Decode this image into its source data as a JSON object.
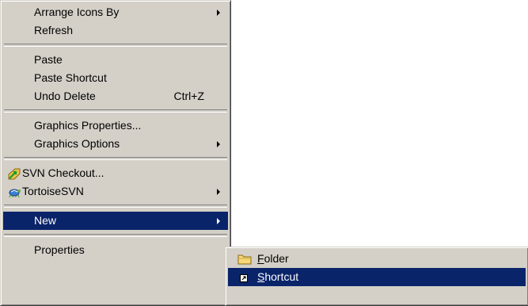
{
  "context_menu": {
    "items": [
      {
        "label": "Arrange Icons By"
      },
      {
        "label": "Refresh"
      },
      {
        "label": "Paste"
      },
      {
        "label": "Paste Shortcut"
      },
      {
        "label": "Undo Delete",
        "accel": "Ctrl+Z"
      },
      {
        "label": "Graphics Properties..."
      },
      {
        "label": "Graphics Options"
      },
      {
        "label": "SVN Checkout...",
        "icon": "svn-checkout-icon"
      },
      {
        "label": "TortoiseSVN",
        "icon": "tortoisesvn-icon"
      },
      {
        "label": "New",
        "state": "highlighted"
      },
      {
        "label": "Properties"
      }
    ]
  },
  "new_submenu": {
    "items": [
      {
        "mnemonic": "F",
        "rest": "older",
        "icon": "folder-icon"
      },
      {
        "mnemonic": "S",
        "rest": "hortcut",
        "icon": "shortcut-icon",
        "state": "highlighted"
      }
    ]
  },
  "colors": {
    "menu_face": "#d4d0c8",
    "highlight": "#0a246a",
    "highlight_text": "#ffffff",
    "desktop": "#ffffff"
  }
}
